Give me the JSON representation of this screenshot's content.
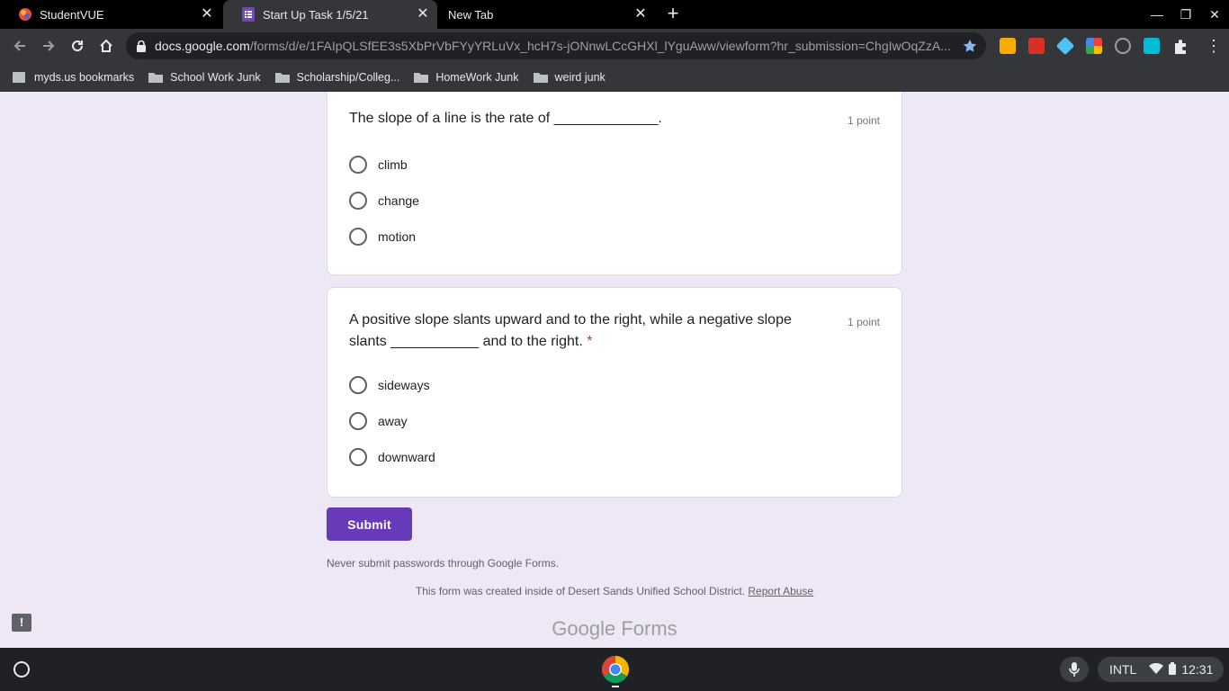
{
  "browser": {
    "tabs": [
      {
        "title": "StudentVUE",
        "icon": "studentvue-icon"
      },
      {
        "title": "Start Up Task 1/5/21",
        "icon": "forms-icon"
      },
      {
        "title": "New Tab",
        "icon": ""
      }
    ],
    "url_host": "docs.google.com",
    "url_path": "/forms/d/e/1FAIpQLSfEE3s5XbPrVbFYyYRLuVx_hcH7s-jONnwLCcGHXl_lYguAww/viewform?hr_submission=ChgIwOqZzA..."
  },
  "bookmarks": [
    {
      "label": "myds.us bookmarks",
      "icon": "page-icon"
    },
    {
      "label": "School Work Junk",
      "icon": "folder-icon"
    },
    {
      "label": "Scholarship/Colleg...",
      "icon": "folder-icon"
    },
    {
      "label": "HomeWork Junk",
      "icon": "folder-icon"
    },
    {
      "label": "weird junk",
      "icon": "folder-icon"
    }
  ],
  "form": {
    "questions": [
      {
        "text": "The slope of a line is the rate of _____________.",
        "required": false,
        "points": "1 point",
        "options": [
          "climb",
          "change",
          "motion"
        ]
      },
      {
        "text": "A positive slope slants upward and to the right, while a negative slope slants ___________ and to the right.",
        "required": true,
        "required_mark": "*",
        "points": "1 point",
        "options": [
          "sideways",
          "away",
          "downward"
        ]
      }
    ],
    "submit_label": "Submit",
    "password_warning": "Never submit passwords through Google Forms.",
    "created_note": "This form was created inside of Desert Sands Unified School District.",
    "report_link": "Report Abuse",
    "brand": "Google Forms",
    "accent_color": "#673ab7"
  },
  "taskbar": {
    "input_method": "INTL",
    "time": "12:31"
  }
}
